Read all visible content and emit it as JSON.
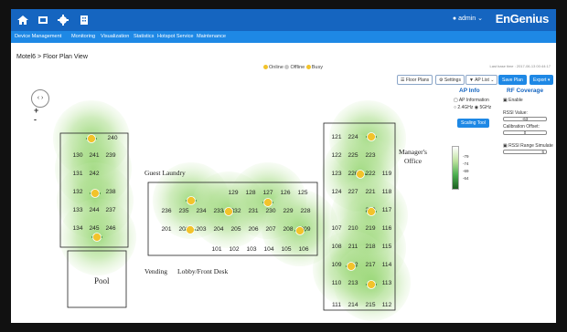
{
  "header": {
    "user": "admin",
    "brand": "EnGenius",
    "icons": [
      "home-icon",
      "device-icon",
      "gear-icon",
      "building-icon"
    ]
  },
  "menu": [
    "Device Management",
    "Monitoring",
    "Visualization",
    "Statistics",
    "Hotspot Service",
    "Maintenance"
  ],
  "breadcrumb": "Motel6 > Floor Plan View",
  "legend": {
    "online": "Online",
    "offline": "Offline",
    "busy": "Busy",
    "colors": {
      "online": "#f2c32b",
      "offline": "#c7c7c7",
      "busy": "#f2c32b"
    }
  },
  "last_sync": "Last base time : 2017-06-13 00:44:17",
  "toolbar": {
    "floor_plans": "Floor Plans",
    "settings": "Settings",
    "ap_list": "AP List",
    "save_plan": "Save Plan",
    "export": "Export"
  },
  "zoom": {
    "in": "+",
    "out": "-"
  },
  "panel": {
    "ap_info": "AP Info",
    "ap_information": "AP Information",
    "band": "2.4GHz ◉ 5GHz",
    "scaling_tool": "Scaling Tool",
    "rf_coverage": "RF Coverage",
    "enable": "Enable",
    "rssi_value_label": "RSSI Value:",
    "rssi_value": "-63",
    "calibration_label": "Calibration Offset:",
    "calibration_value": "0",
    "rssi_range_label": "RSSI Range Simulate",
    "rssi_range_value": "6",
    "scale": [
      "-79",
      "-74",
      "-69",
      "-64"
    ]
  },
  "floorplan": {
    "labels": {
      "guest_laundry": "Guest Laundry",
      "managers_office_1": "Manager's",
      "managers_office_2": "Office",
      "pool": "Pool",
      "vending": "Vending",
      "lobby": "Lobby/Front Desk"
    },
    "left_block": [
      "240",
      "130",
      "241",
      "239",
      "131",
      "242",
      "132",
      "238",
      "133",
      "244",
      "237",
      "134",
      "245",
      "246"
    ],
    "middle_block": [
      "129",
      "128",
      "127",
      "126",
      "125",
      "236",
      "235",
      "234",
      "233",
      "232",
      "231",
      "230",
      "229",
      "228",
      "201",
      "202",
      "203",
      "204",
      "205",
      "206",
      "207",
      "208",
      "209",
      "101",
      "102",
      "103",
      "104",
      "105",
      "106"
    ],
    "right_block": [
      "121",
      "224",
      "122",
      "225",
      "223",
      "123",
      "226",
      "222",
      "119",
      "124",
      "227",
      "221",
      "118",
      "220",
      "117",
      "107",
      "210",
      "219",
      "116",
      "108",
      "211",
      "218",
      "115",
      "109",
      "212",
      "217",
      "114",
      "110",
      "213",
      "113",
      "111",
      "214",
      "215",
      "112"
    ]
  }
}
